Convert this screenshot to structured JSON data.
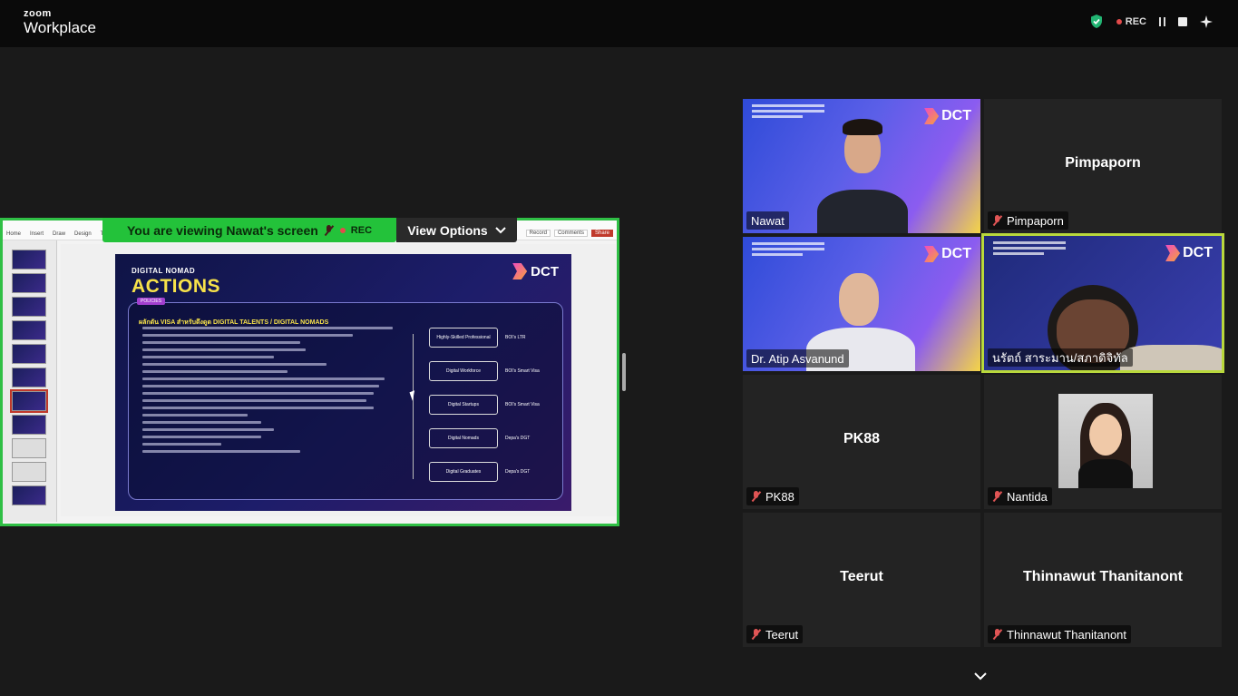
{
  "app": {
    "brand_top": "zoom",
    "brand_bottom": "Workplace"
  },
  "topbar": {
    "rec_label": "REC"
  },
  "share": {
    "banner_text": "You are viewing  Nawat's screen",
    "banner_rec": "REC",
    "view_options": "View Options",
    "toolbar_menu": [
      "Home",
      "Insert",
      "Draw",
      "Design",
      "Transitions"
    ],
    "toolbar_right": [
      "Record",
      "Comments",
      "Share"
    ],
    "slide": {
      "kicker": "DIGITAL NOMAD",
      "title": "ACTIONS",
      "pill": "POLICIES",
      "heading": "ผลักดัน VISA สำหรับดึงดูด DIGITAL TALENTS / DIGITAL NOMADS",
      "brand": "DCT",
      "boxes": [
        {
          "box": "Highly-Skilled Professional",
          "label": "BOI's LTR"
        },
        {
          "box": "Digital Workforce",
          "label": "BOI's Smart Visa"
        },
        {
          "box": "Digital Startups",
          "label": "BOI's Smart Visa"
        },
        {
          "box": "Digital Nomads",
          "label": "Depa's DGT"
        },
        {
          "box": "Digital Graduates",
          "label": "Depa's DGT"
        }
      ]
    }
  },
  "participants": [
    {
      "name": "Nawat",
      "video": true,
      "muted": false
    },
    {
      "name": "Pimpaporn",
      "video": false,
      "muted": true,
      "display": "Pimpaporn"
    },
    {
      "name": "Dr. Atip Asvanund",
      "video": true,
      "muted": false
    },
    {
      "name": "นรัตถ์ สาระมาน/สภาดิจิทัล",
      "video": true,
      "muted": false,
      "active": true
    },
    {
      "name": "PK88",
      "video": false,
      "muted": true,
      "display": "PK88"
    },
    {
      "name": "Nantida",
      "video": true,
      "muted": true
    },
    {
      "name": "Teerut",
      "video": false,
      "muted": true,
      "display": "Teerut"
    },
    {
      "name": "Thinnawut Thanitanont",
      "video": false,
      "muted": true,
      "display": "Thinnawut Thanitanont"
    }
  ],
  "colors": {
    "active_speaker": "#b9d83c",
    "share_border": "#2fbf45",
    "rec": "#e34b4b"
  },
  "icons": [
    "shield-check-icon",
    "record-dot-icon",
    "pause-icon",
    "stop-icon",
    "sparkle-icon",
    "mic-off-icon",
    "chevron-down-icon",
    "mouse-cursor-icon"
  ]
}
